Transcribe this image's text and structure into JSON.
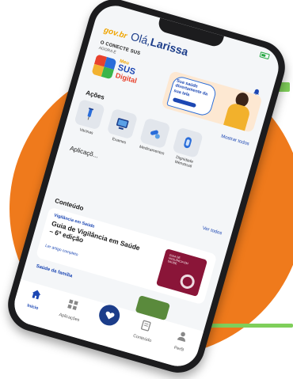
{
  "header": {
    "brand": "gov.br",
    "greeting_prefix": "Olá,",
    "user_name": "Larissa"
  },
  "banner": {
    "title": "O CONECTE SUS",
    "subtitle": "AGORA É",
    "logo_line1": "Meu",
    "logo_line2": "SUS",
    "logo_line3": "Digital",
    "promo_text": "Sua saúde divertamente da sua tela"
  },
  "actions": {
    "title": "Ações",
    "show_all": "Mostrar todos",
    "items": [
      {
        "label": "Vacinas",
        "icon": "syringe-icon"
      },
      {
        "label": "Exames",
        "icon": "monitor-icon"
      },
      {
        "label": "Medicamentos",
        "icon": "pills-icon"
      },
      {
        "label": "Dignidade Menstrual",
        "icon": "pad-icon"
      }
    ]
  },
  "applications": {
    "title": "Aplicaçõ...",
    "see_all": "Ver todos"
  },
  "content": {
    "title": "Conteúdo",
    "card": {
      "tag": "Vigilância em Saúde",
      "headline": "Guia de Vigilância em Saúde – 6ª edição",
      "read_link": "Ler artigo completo",
      "cover_title": "GUIA DE VIGILÂNCIA EM SAÚDE"
    },
    "next_tag": "Saúde da família"
  },
  "tabbar": {
    "items": [
      {
        "label": "Início",
        "icon": "home-icon",
        "active": true
      },
      {
        "label": "Aplicações",
        "icon": "grid-icon",
        "active": false
      },
      {
        "label": "",
        "icon": "heart-icon",
        "active": false
      },
      {
        "label": "Conteúdo",
        "icon": "document-icon",
        "active": false
      },
      {
        "label": "Perfil",
        "icon": "person-icon",
        "active": false
      }
    ]
  },
  "colors": {
    "accent": "#1c47b3",
    "background_circle": "#ef7a1c",
    "green_accent": "#7fcf5a"
  }
}
